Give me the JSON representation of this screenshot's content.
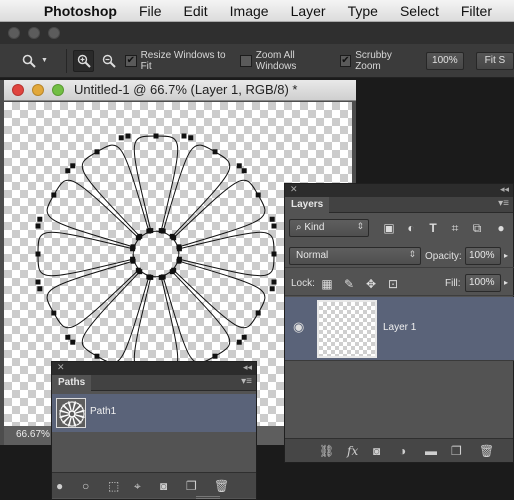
{
  "menubar": {
    "apple_icon": "apple-icon",
    "app_name": "Photoshop",
    "items": [
      "File",
      "Edit",
      "Image",
      "Layer",
      "Type",
      "Select",
      "Filter"
    ]
  },
  "options_bar": {
    "zoom_in_icon": "zoom-in-icon",
    "zoom_out_icon": "zoom-out-icon",
    "resize_windows": {
      "label": "Resize Windows to Fit",
      "checked": true
    },
    "zoom_all_windows": {
      "label": "Zoom All Windows",
      "checked": false
    },
    "scrubby_zoom": {
      "label": "Scrubby Zoom",
      "checked": true
    },
    "zoom_value": "100%",
    "fit_label": "Fit S"
  },
  "document": {
    "title": "Untitled-1 @ 66.7% (Layer 1, RGB/8) *",
    "zoom": "66.67%"
  },
  "layers_panel": {
    "tab": "Layers",
    "filter_kind": "Kind",
    "blend_mode": "Normal",
    "opacity_label": "Opacity:",
    "opacity": "100%",
    "lock_label": "Lock:",
    "fill_label": "Fill:",
    "fill": "100%",
    "layers": [
      {
        "name": "Layer 1",
        "visible": true
      }
    ]
  },
  "paths_panel": {
    "tab": "Paths",
    "paths": [
      {
        "name": "Path1"
      }
    ]
  },
  "colors": {
    "panel_bg": "#535353",
    "selected_row": "#5a6379",
    "toolbar_bg": "#3b3b3b"
  }
}
